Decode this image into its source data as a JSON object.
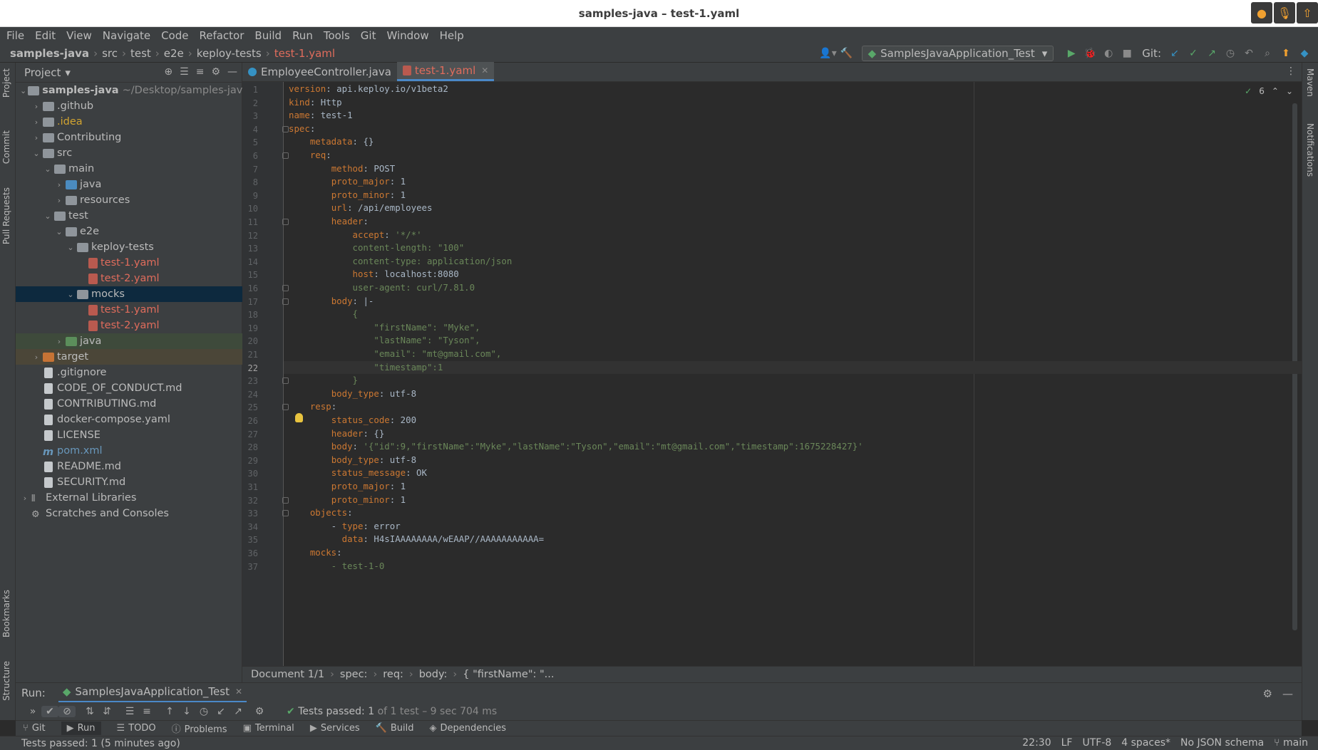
{
  "window": {
    "title": "samples-java – test-1.yaml"
  },
  "menu": [
    "File",
    "Edit",
    "View",
    "Navigate",
    "Code",
    "Refactor",
    "Build",
    "Run",
    "Tools",
    "Git",
    "Window",
    "Help"
  ],
  "breadcrumbs": [
    "samples-java",
    "src",
    "test",
    "e2e",
    "keploy-tests",
    "test-1.yaml"
  ],
  "toolbar": {
    "run_config": "SamplesJavaApplication_Test",
    "git_label": "Git:"
  },
  "project_panel": {
    "title": "Project",
    "tree": [
      {
        "label": "samples-java",
        "path": "~/Desktop/samples-java"
      },
      {
        "label": ".github"
      },
      {
        "label": ".idea"
      },
      {
        "label": "Contributing"
      },
      {
        "label": "src"
      },
      {
        "label": "main"
      },
      {
        "label": "java"
      },
      {
        "label": "resources"
      },
      {
        "label": "test"
      },
      {
        "label": "e2e"
      },
      {
        "label": "keploy-tests"
      },
      {
        "label": "test-1.yaml"
      },
      {
        "label": "test-2.yaml"
      },
      {
        "label": "mocks"
      },
      {
        "label": "test-1.yaml"
      },
      {
        "label": "test-2.yaml"
      },
      {
        "label": "java"
      },
      {
        "label": "target"
      },
      {
        "label": ".gitignore"
      },
      {
        "label": "CODE_OF_CONDUCT.md"
      },
      {
        "label": "CONTRIBUTING.md"
      },
      {
        "label": "docker-compose.yaml"
      },
      {
        "label": "LICENSE"
      },
      {
        "label": "pom.xml"
      },
      {
        "label": "README.md"
      },
      {
        "label": "SECURITY.md"
      },
      {
        "label": "External Libraries"
      },
      {
        "label": "Scratches and Consoles"
      }
    ]
  },
  "editor_tabs": [
    {
      "label": "EmployeeController.java",
      "active": false
    },
    {
      "label": "test-1.yaml",
      "active": true
    }
  ],
  "editor": {
    "inspection_count": "6",
    "current_line": 22,
    "lines": [
      "version: api.keploy.io/v1beta2",
      "kind: Http",
      "name: test-1",
      "spec:",
      "    metadata: {}",
      "    req:",
      "        method: POST",
      "        proto_major: 1",
      "        proto_minor: 1",
      "        url: /api/employees",
      "        header:",
      "            accept: '*/*'",
      "            content-length: \"100\"",
      "            content-type: application/json",
      "            host: localhost:8080",
      "            user-agent: curl/7.81.0",
      "        body: |-",
      "            {",
      "                \"firstName\": \"Myke\",",
      "                \"lastName\": \"Tyson\",",
      "                \"email\": \"mt@gmail.com\",",
      "                \"timestamp\":1",
      "            }",
      "        body_type: utf-8",
      "    resp:",
      "        status_code: 200",
      "        header: {}",
      "        body: '{\"id\":9,\"firstName\":\"Myke\",\"lastName\":\"Tyson\",\"email\":\"mt@gmail.com\",\"timestamp\":1675228427}'",
      "        body_type: utf-8",
      "        status_message: OK",
      "        proto_major: 1",
      "        proto_minor: 1",
      "    objects:",
      "        - type: error",
      "          data: H4sIAAAAAAAA/wEAAP//AAAAAAAAAAA=",
      "    mocks:",
      "        - test-1-0"
    ]
  },
  "editor_breadcrumb": [
    "Document 1/1",
    "spec:",
    "req:",
    "body:",
    "{  \"firstName\": \"..."
  ],
  "run_panel": {
    "label": "Run:",
    "tab": "SamplesJavaApplication_Test",
    "result_main": "Tests passed: 1",
    "result_detail": " of 1 test – 9 sec 704 ms"
  },
  "tool_tabs": [
    "Git",
    "Run",
    "TODO",
    "Problems",
    "Terminal",
    "Services",
    "Build",
    "Dependencies"
  ],
  "left_stripe": [
    "Project",
    "Commit",
    "Pull Requests",
    "Bookmarks",
    "Structure"
  ],
  "right_stripe": [
    "Maven",
    "Notifications"
  ],
  "status": {
    "message": "Tests passed: 1 (5 minutes ago)",
    "position": "22:30",
    "line_sep": "LF",
    "encoding": "UTF-8",
    "indent": "4 spaces*",
    "schema": "No JSON schema",
    "branch": "main"
  }
}
